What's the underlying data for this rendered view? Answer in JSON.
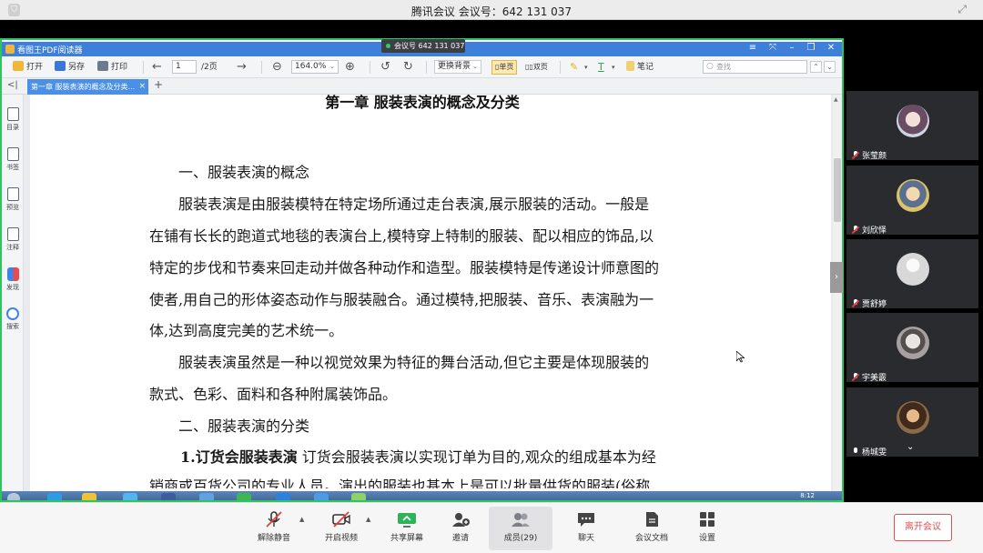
{
  "meeting": {
    "title": "腾讯会议 会议号：642 131 037",
    "share_badge": "会议号 642 131 037"
  },
  "reader": {
    "app_name": "看图王PDF阅读器",
    "toolbar": {
      "open": "打开",
      "save_as": "另存",
      "print": "打印",
      "page_current": "1",
      "page_total": "/2页",
      "zoom": "164.0%",
      "background": "更换背景",
      "single_page": "单页",
      "double_page": "双页",
      "notes": "笔记",
      "search_placeholder": "查找"
    },
    "tab": {
      "label": "第一章 服装表演的概念及分类..."
    },
    "sidebar": [
      "目录",
      "书签",
      "预览",
      "注释",
      "发现",
      "搜索"
    ],
    "document": {
      "title": "第一章  服装表演的概念及分类",
      "lines": [
        "　　一、服装表演的概念",
        "　　服装表演是由服装模特在特定场所通过走台表演,展示服装的活动。一般是",
        "在铺有长长的跑道式地毯的表演台上,模特穿上特制的服装、配以相应的饰品,以",
        "特定的步伐和节奏来回走动并做各种动作和造型。服装模特是传递设计师意图的",
        "使者,用自己的形体姿态动作与服装融合。通过模特,把服装、音乐、表演融为一",
        "体,达到高度完美的艺术统一。",
        "　　服装表演虽然是一种以视觉效果为特征的舞台活动,但它主要是体现服装的",
        "款式、色彩、面料和各种附属装饰品。",
        "　　二、服装表演的分类"
      ],
      "para_heading": "1.订货会服装表演",
      "para_text": "  订货会服装表演以实现订单为目的,观众的组成基本为经",
      "last_line": "销商或百货公司的专业人员。演出的服装也基本上是可以批量供货的服装(俗称"
    },
    "clock": "8:12"
  },
  "participants": [
    {
      "name": "张莹颜",
      "avatar_color": "#c9a7a0"
    },
    {
      "name": "刘欣怿",
      "avatar_color": "#8b9bb4"
    },
    {
      "name": "贾舒婷",
      "avatar_color": "#d8d8d8"
    },
    {
      "name": "宇美霰",
      "avatar_color": "#b7b1b3"
    },
    {
      "name": "杨城雯",
      "avatar_color": "#7a5a3f"
    }
  ],
  "bottom_bar": {
    "mute": "解除静音",
    "video": "开启视频",
    "share": "共享屏幕",
    "invite": "邀请",
    "members": "成员(29)",
    "chat": "聊天",
    "docs": "会议文档",
    "settings": "设置",
    "leave": "离开会议"
  },
  "colors": {
    "share_border": "#2fc45d",
    "reader_blue": "#3d7fd9",
    "leave_red": "#e05050"
  }
}
